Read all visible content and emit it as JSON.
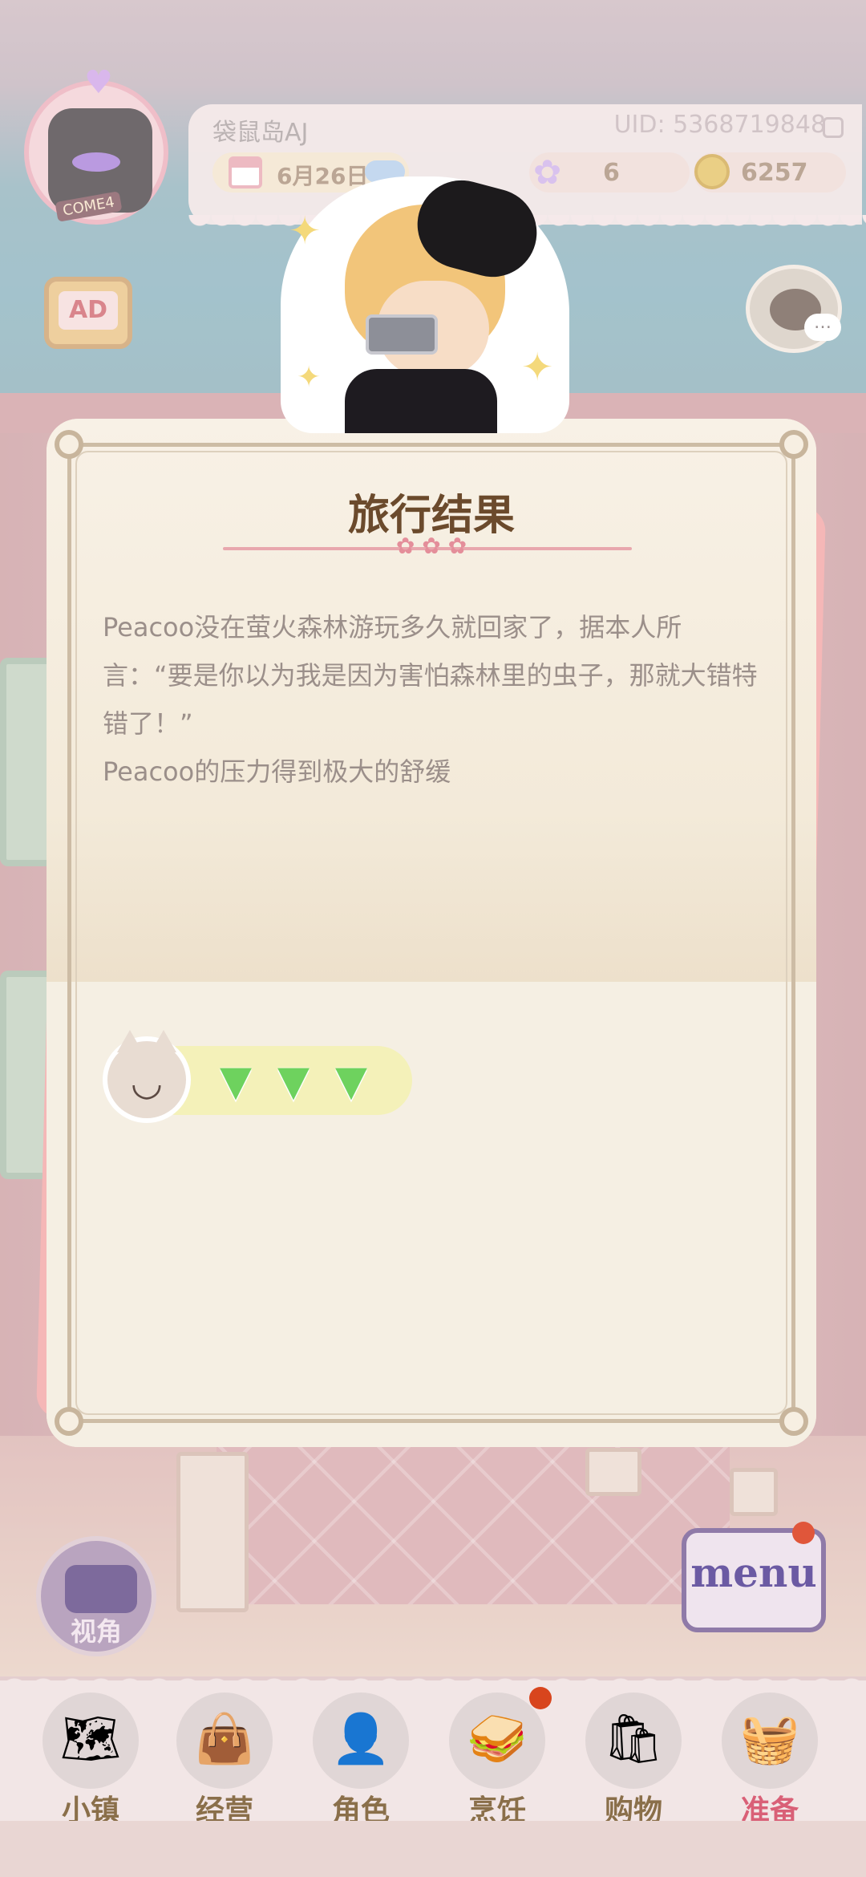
{
  "header": {
    "username": "袋鼠岛AJ",
    "uid": "UID: 5368719848",
    "date": "6月26日",
    "gems": "6",
    "coins": "6257",
    "avatar_tag": "COME4"
  },
  "side": {
    "ad_label": "AD",
    "chat_glyph": "…"
  },
  "dialog": {
    "title": "旅行结果",
    "title_ornament": "✿ ✿ ✿",
    "paragraph1": "Peacoo没在萤火森林游玩多久就回家了，据本人所言：“要是你以为我是因为害怕森林里的虫子，那就大错特错了！”",
    "paragraph2": "Peacoo的压力得到极大的舒缓",
    "effect_arrows": [
      "▼",
      "▼",
      "▼"
    ],
    "effect_count": 3,
    "effect_color": "#6ed25e"
  },
  "controls": {
    "camera_label": "视角",
    "menu_label": "menu"
  },
  "nav": {
    "items": [
      {
        "label": "小镇",
        "icon": "map-icon",
        "glyph": "🗺"
      },
      {
        "label": "经营",
        "icon": "shop-bag-lock-icon",
        "glyph": "👜"
      },
      {
        "label": "角色",
        "icon": "character-icon",
        "glyph": "👤"
      },
      {
        "label": "烹饪",
        "icon": "cooking-icon",
        "glyph": "🥪"
      },
      {
        "label": "购物",
        "icon": "shopping-bag-icon",
        "glyph": "🛍"
      },
      {
        "label": "准备",
        "icon": "basket-icon",
        "glyph": "🧺"
      }
    ],
    "active_index": 5
  },
  "colors": {
    "title": "#6b4a2c",
    "body_text": "#9b8f8a",
    "nav_label": "#8a6f4a",
    "nav_active": "#d96077",
    "notification": "#d8451d"
  }
}
